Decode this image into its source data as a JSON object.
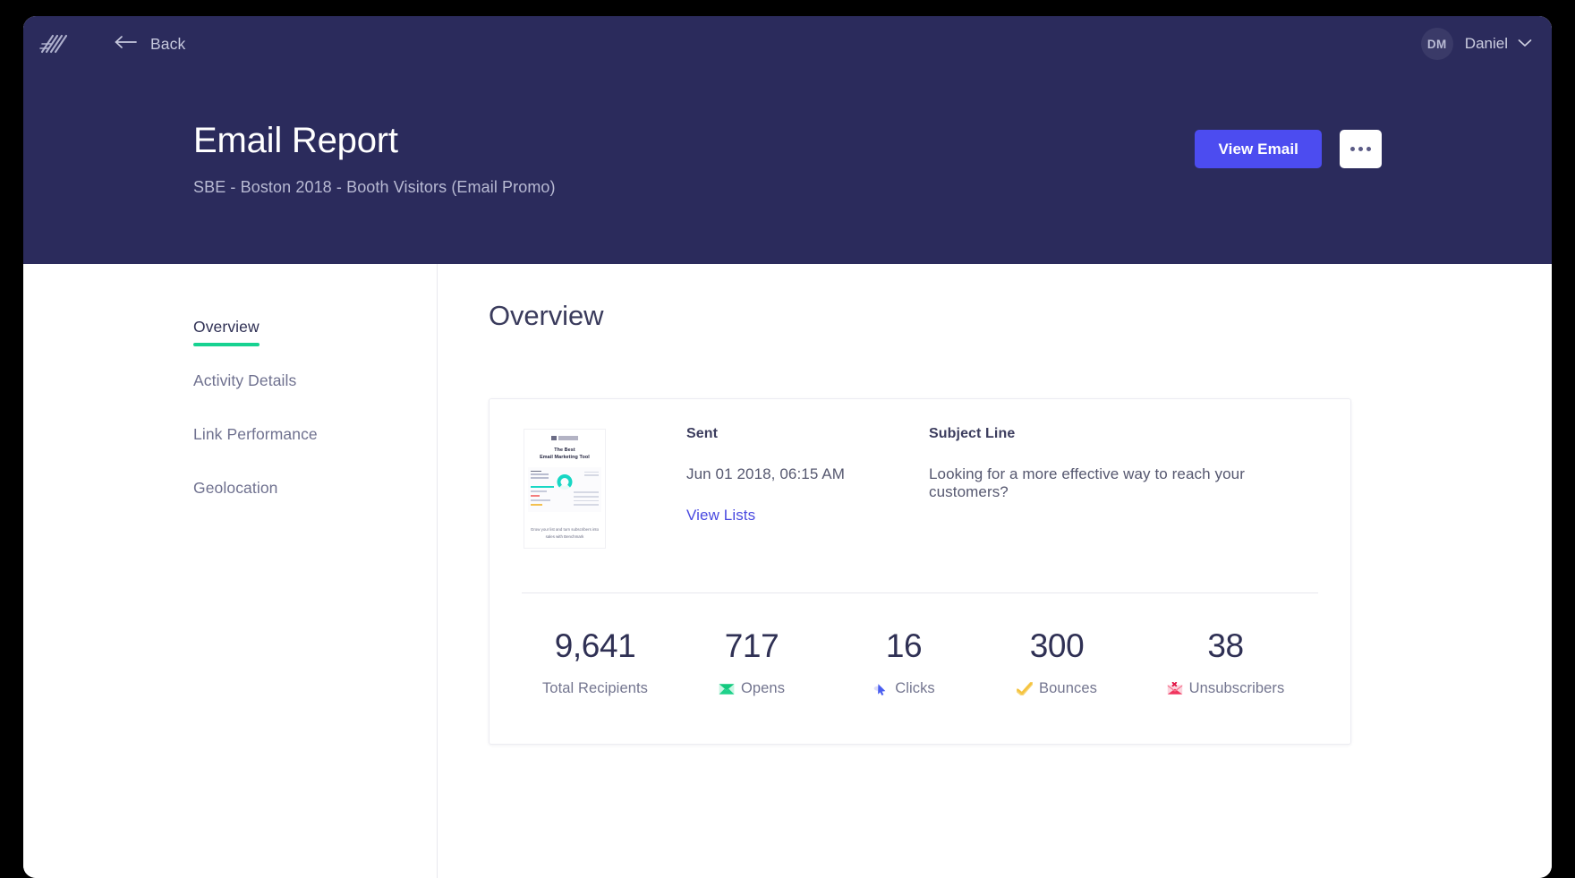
{
  "topbar": {
    "logo_icon": "benchmark-slashes-logo",
    "back_icon": "arrow-left-icon",
    "back_label": "Back",
    "avatar_initials": "DM",
    "user_name": "Daniel",
    "chevron_icon": "chevron-down-icon"
  },
  "header": {
    "title": "Email Report",
    "subtitle": "SBE - Boston 2018 - Booth Visitors (Email Promo)",
    "view_email_label": "View Email",
    "more_icon": "ellipsis-icon",
    "bg_color": "#2b2b5c",
    "accent_color": "#4c4cf0"
  },
  "sidebar": {
    "items": [
      {
        "label": "Overview",
        "active": true
      },
      {
        "label": "Activity Details",
        "active": false
      },
      {
        "label": "Link Performance",
        "active": false
      },
      {
        "label": "Geolocation",
        "active": false
      }
    ],
    "active_underline_color": "#17d291"
  },
  "main": {
    "section_title": "Overview"
  },
  "card": {
    "thumbnail": {
      "heading_line1": "The Best",
      "heading_line2": "Email Marketing Tool",
      "footer_line1": "Grow your list and turn subscribers into",
      "footer_line2": "sales with Benchmark"
    },
    "sent": {
      "label": "Sent",
      "value": "Jun 01 2018, 06:15 AM",
      "view_lists_label": "View Lists"
    },
    "subject": {
      "label": "Subject Line",
      "value": "Looking for a more effective way to reach your customers?"
    },
    "stats": [
      {
        "value": "9,641",
        "label": "Total Recipients",
        "icon": "",
        "icon_color": ""
      },
      {
        "value": "717",
        "label": "Opens",
        "icon": "green-envelope-icon",
        "icon_color": "#1fd18a"
      },
      {
        "value": "16",
        "label": "Clicks",
        "icon": "blue-cursor-icon",
        "icon_color": "#4a5ef0"
      },
      {
        "value": "300",
        "label": "Bounces",
        "icon": "yellow-check-icon",
        "icon_color": "#f5c33e"
      },
      {
        "value": "38",
        "label": "Unsubscribers",
        "icon": "red-envelope-x-icon",
        "icon_color": "#f0355e"
      }
    ]
  }
}
